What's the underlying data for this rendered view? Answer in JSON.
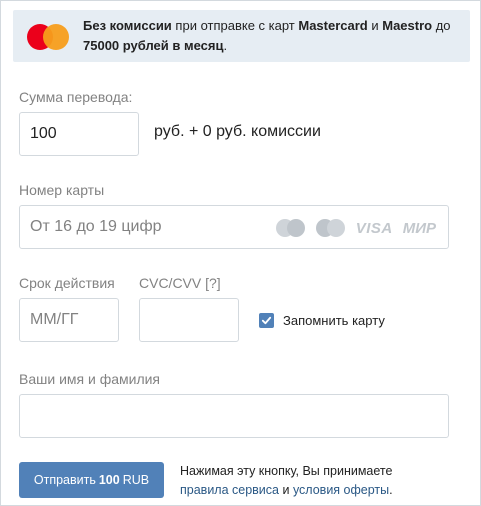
{
  "banner": {
    "bold_prefix": "Без комиссии",
    "text1": " при отправке с карт ",
    "brand1": "Mastercard",
    "text2": " и ",
    "brand2": "Maestro",
    "text3": " до ",
    "bold_limit": "75000 рублей в месяц",
    "text4": "."
  },
  "amount": {
    "label": "Сумма перевода:",
    "value": "100",
    "hint": "руб. + 0 руб. комиссии"
  },
  "card_number": {
    "label": "Номер карты",
    "placeholder": "От 16 до 19 цифр",
    "visa_text": "VISA",
    "mir_text": "МИР"
  },
  "expiry": {
    "label": "Срок действия",
    "placeholder": "ММ/ГГ"
  },
  "cvc": {
    "label": "CVC/CVV [?]",
    "value": ""
  },
  "remember": {
    "label": "Запомнить карту",
    "checked": true
  },
  "name": {
    "label": "Ваши имя и фамилия",
    "value": ""
  },
  "submit": {
    "prefix": "Отправить",
    "amount": "100",
    "currency": "RUB"
  },
  "legal": {
    "text": "Нажимая эту кнопку, Вы принимаете",
    "link1": "правила сервиса",
    "and": " и ",
    "link2": "условия оферты",
    "end": "."
  },
  "colors": {
    "accent": "#5181b8",
    "banner_bg": "#e6edf3",
    "link": "#2a5885",
    "label": "#828282"
  }
}
